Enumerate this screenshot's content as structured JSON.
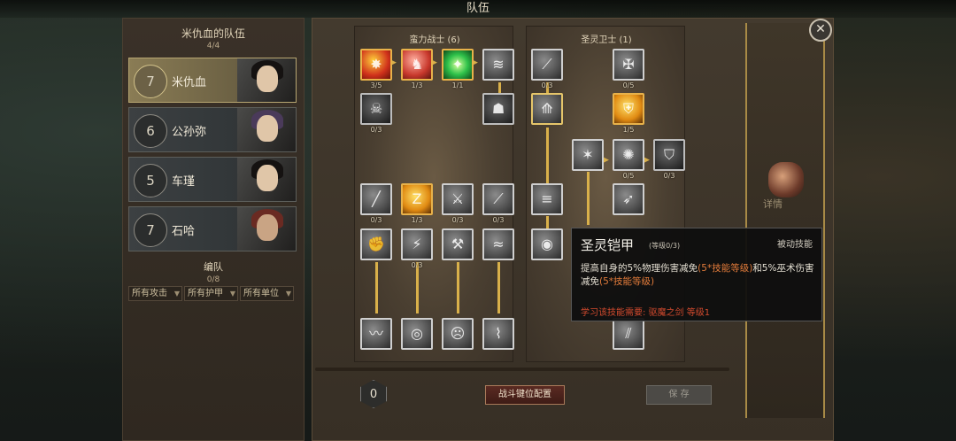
{
  "screen_title": "队伍",
  "team": {
    "header": "米仇血的队伍",
    "count": "4/4",
    "members": [
      {
        "level": "7",
        "name": "米仇血",
        "selected": true
      },
      {
        "level": "6",
        "name": "公孙弥",
        "selected": false
      },
      {
        "level": "5",
        "name": "车瑾",
        "selected": false
      },
      {
        "level": "7",
        "name": "石哈",
        "selected": false
      }
    ]
  },
  "formation": {
    "header": "编队",
    "count": "0/8",
    "filters": [
      "所有攻击",
      "所有护甲",
      "所有单位"
    ]
  },
  "trees": [
    {
      "title": "蛮力战士 (6)",
      "counts": [
        "3/5",
        "1/3",
        "1/1",
        "0/3",
        "0/3",
        "1/3",
        "0/3",
        "0/3",
        "0/3"
      ]
    },
    {
      "title": "圣灵卫士 (1)",
      "counts": [
        "0/3",
        "0/5",
        "1/5",
        "0/5",
        "0/3"
      ]
    }
  ],
  "detail_label": "详情",
  "skill_points": "0",
  "buttons": {
    "config": "战斗键位配置",
    "save": "保 存"
  },
  "tooltip": {
    "name": "圣灵铠甲",
    "level": "(等级0/3)",
    "type": "被动技能",
    "desc_prefix": "提高自身的5%物理伤害减免",
    "desc_hl1": "(5*技能等级)",
    "desc_mid": "和5%巫术伤害减免",
    "desc_hl2": "(5*技能等级)",
    "requirement": "学习该技能需要: 驱魔之剑 等级1"
  },
  "colors": {
    "accent_gold": "#d9b04a",
    "requirement_red": "#d24a2e",
    "highlight_orange": "#e07a3a"
  }
}
